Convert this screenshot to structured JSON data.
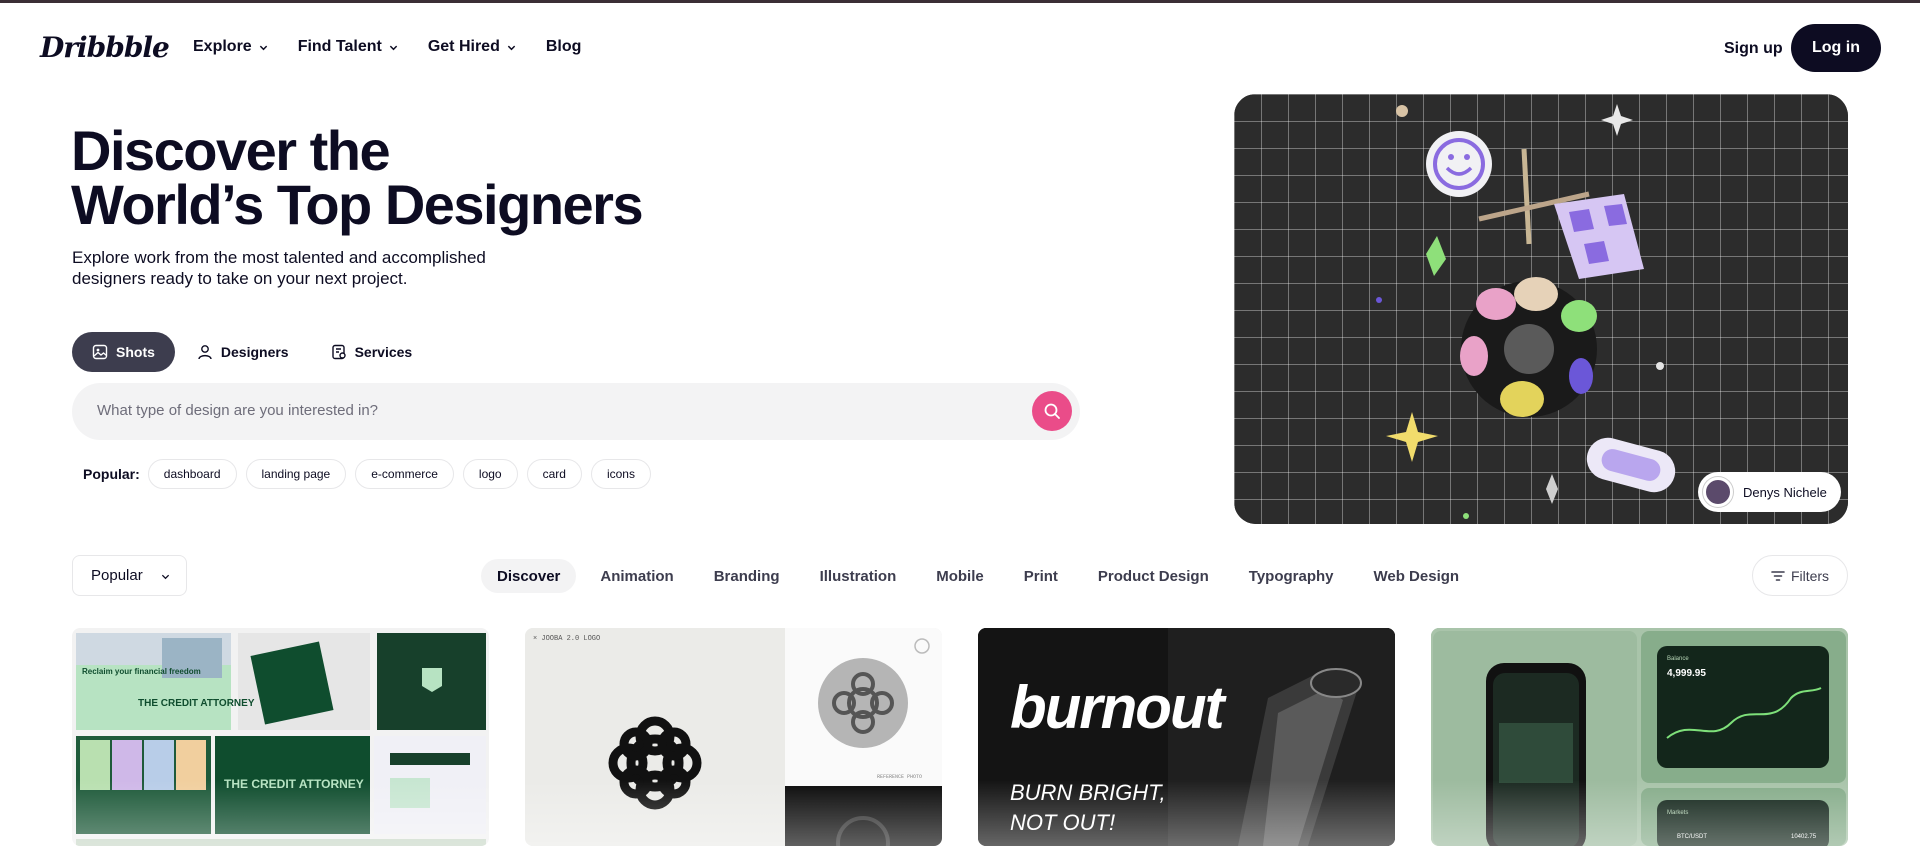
{
  "nav": {
    "logo": "Dribbble",
    "links": [
      {
        "label": "Explore",
        "has_dropdown": true
      },
      {
        "label": "Find Talent",
        "has_dropdown": true
      },
      {
        "label": "Get Hired",
        "has_dropdown": true
      },
      {
        "label": "Blog",
        "has_dropdown": false
      }
    ],
    "signup_label": "Sign up",
    "login_label": "Log in"
  },
  "hero": {
    "title_line1": "Discover the",
    "title_line2": "World’s Top Designers",
    "subtitle": "Explore work from the most talented and accomplished designers ready to take on your next project.",
    "tabs": [
      {
        "label": "Shots",
        "icon": "image-icon",
        "active": true
      },
      {
        "label": "Designers",
        "icon": "user-icon",
        "active": false
      },
      {
        "label": "Services",
        "icon": "services-icon",
        "active": false
      }
    ],
    "search": {
      "placeholder": "What type of design are you interested in?"
    },
    "popular_label": "Popular:",
    "popular_tags": [
      "dashboard",
      "landing page",
      "e-commerce",
      "logo",
      "card",
      "icons"
    ],
    "image_credit": "Denys Nichele"
  },
  "filter_bar": {
    "sort_value": "Popular",
    "categories": [
      "Discover",
      "Animation",
      "Branding",
      "Illustration",
      "Mobile",
      "Print",
      "Product Design",
      "Typography",
      "Web Design"
    ],
    "active_category": "Discover",
    "filters_label": "Filters"
  },
  "shots": {
    "shot1": {
      "text1": "Reclaim your financial freedom",
      "text2": "THE CREDIT ATTORNEY",
      "text3": "THE CREDIT ATTORNEY"
    },
    "shot2": {
      "caption": "× JOOBA 2.0 LOGO",
      "ref": "REFERENCE PHOTO"
    },
    "shot3": {
      "brand": "burnout",
      "tagline1": "BURN BRIGHT,",
      "tagline2": "NOT OUT!"
    },
    "shot4": {
      "balance_label": "Balance",
      "balance_value": "4,999.95",
      "markets_label": "Markets",
      "pair": "BTC/USDT",
      "price": "10402.75"
    }
  },
  "colors": {
    "accent": "#ea4c89",
    "dark": "#0d0c22",
    "tab_active": "#3d3d4e"
  }
}
